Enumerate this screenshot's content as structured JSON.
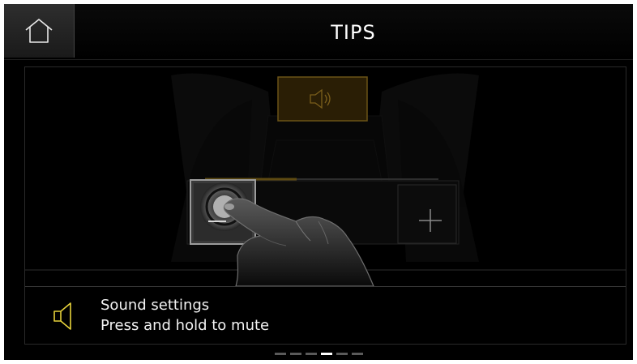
{
  "header": {
    "title": "TIPS",
    "home_icon": "home-icon"
  },
  "tip": {
    "title": "Sound settings",
    "description": "Press and hold to mute",
    "icon": "speaker-icon",
    "accent_color": "#e6d13a",
    "illustration": {
      "top_button_icon": "speaker-sound-icon",
      "minus_button_icon": "minus-icon",
      "plus_button_icon": "plus-icon",
      "hand_icon": "pointing-hand-icon"
    }
  },
  "pager": {
    "count": 6,
    "active_index": 3
  }
}
